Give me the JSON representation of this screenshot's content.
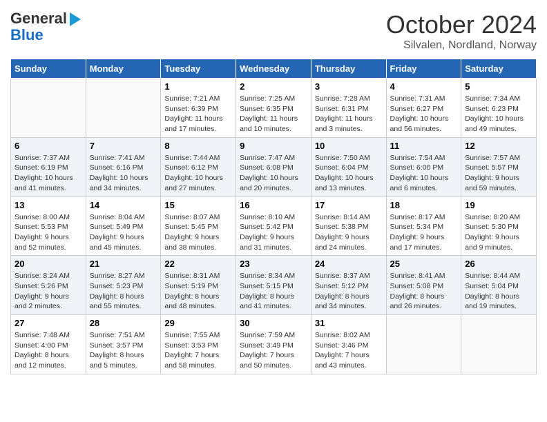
{
  "header": {
    "logo_line1": "General",
    "logo_line2": "Blue",
    "month": "October 2024",
    "location": "Silvalen, Nordland, Norway"
  },
  "weekdays": [
    "Sunday",
    "Monday",
    "Tuesday",
    "Wednesday",
    "Thursday",
    "Friday",
    "Saturday"
  ],
  "weeks": [
    [
      {
        "day": "",
        "info": ""
      },
      {
        "day": "",
        "info": ""
      },
      {
        "day": "1",
        "info": "Sunrise: 7:21 AM\nSunset: 6:39 PM\nDaylight: 11 hours and 17 minutes."
      },
      {
        "day": "2",
        "info": "Sunrise: 7:25 AM\nSunset: 6:35 PM\nDaylight: 11 hours and 10 minutes."
      },
      {
        "day": "3",
        "info": "Sunrise: 7:28 AM\nSunset: 6:31 PM\nDaylight: 11 hours and 3 minutes."
      },
      {
        "day": "4",
        "info": "Sunrise: 7:31 AM\nSunset: 6:27 PM\nDaylight: 10 hours and 56 minutes."
      },
      {
        "day": "5",
        "info": "Sunrise: 7:34 AM\nSunset: 6:23 PM\nDaylight: 10 hours and 49 minutes."
      }
    ],
    [
      {
        "day": "6",
        "info": "Sunrise: 7:37 AM\nSunset: 6:19 PM\nDaylight: 10 hours and 41 minutes."
      },
      {
        "day": "7",
        "info": "Sunrise: 7:41 AM\nSunset: 6:16 PM\nDaylight: 10 hours and 34 minutes."
      },
      {
        "day": "8",
        "info": "Sunrise: 7:44 AM\nSunset: 6:12 PM\nDaylight: 10 hours and 27 minutes."
      },
      {
        "day": "9",
        "info": "Sunrise: 7:47 AM\nSunset: 6:08 PM\nDaylight: 10 hours and 20 minutes."
      },
      {
        "day": "10",
        "info": "Sunrise: 7:50 AM\nSunset: 6:04 PM\nDaylight: 10 hours and 13 minutes."
      },
      {
        "day": "11",
        "info": "Sunrise: 7:54 AM\nSunset: 6:00 PM\nDaylight: 10 hours and 6 minutes."
      },
      {
        "day": "12",
        "info": "Sunrise: 7:57 AM\nSunset: 5:57 PM\nDaylight: 9 hours and 59 minutes."
      }
    ],
    [
      {
        "day": "13",
        "info": "Sunrise: 8:00 AM\nSunset: 5:53 PM\nDaylight: 9 hours and 52 minutes."
      },
      {
        "day": "14",
        "info": "Sunrise: 8:04 AM\nSunset: 5:49 PM\nDaylight: 9 hours and 45 minutes."
      },
      {
        "day": "15",
        "info": "Sunrise: 8:07 AM\nSunset: 5:45 PM\nDaylight: 9 hours and 38 minutes."
      },
      {
        "day": "16",
        "info": "Sunrise: 8:10 AM\nSunset: 5:42 PM\nDaylight: 9 hours and 31 minutes."
      },
      {
        "day": "17",
        "info": "Sunrise: 8:14 AM\nSunset: 5:38 PM\nDaylight: 9 hours and 24 minutes."
      },
      {
        "day": "18",
        "info": "Sunrise: 8:17 AM\nSunset: 5:34 PM\nDaylight: 9 hours and 17 minutes."
      },
      {
        "day": "19",
        "info": "Sunrise: 8:20 AM\nSunset: 5:30 PM\nDaylight: 9 hours and 9 minutes."
      }
    ],
    [
      {
        "day": "20",
        "info": "Sunrise: 8:24 AM\nSunset: 5:26 PM\nDaylight: 9 hours and 2 minutes."
      },
      {
        "day": "21",
        "info": "Sunrise: 8:27 AM\nSunset: 5:23 PM\nDaylight: 8 hours and 55 minutes."
      },
      {
        "day": "22",
        "info": "Sunrise: 8:31 AM\nSunset: 5:19 PM\nDaylight: 8 hours and 48 minutes."
      },
      {
        "day": "23",
        "info": "Sunrise: 8:34 AM\nSunset: 5:15 PM\nDaylight: 8 hours and 41 minutes."
      },
      {
        "day": "24",
        "info": "Sunrise: 8:37 AM\nSunset: 5:12 PM\nDaylight: 8 hours and 34 minutes."
      },
      {
        "day": "25",
        "info": "Sunrise: 8:41 AM\nSunset: 5:08 PM\nDaylight: 8 hours and 26 minutes."
      },
      {
        "day": "26",
        "info": "Sunrise: 8:44 AM\nSunset: 5:04 PM\nDaylight: 8 hours and 19 minutes."
      }
    ],
    [
      {
        "day": "27",
        "info": "Sunrise: 7:48 AM\nSunset: 4:00 PM\nDaylight: 8 hours and 12 minutes."
      },
      {
        "day": "28",
        "info": "Sunrise: 7:51 AM\nSunset: 3:57 PM\nDaylight: 8 hours and 5 minutes."
      },
      {
        "day": "29",
        "info": "Sunrise: 7:55 AM\nSunset: 3:53 PM\nDaylight: 7 hours and 58 minutes."
      },
      {
        "day": "30",
        "info": "Sunrise: 7:59 AM\nSunset: 3:49 PM\nDaylight: 7 hours and 50 minutes."
      },
      {
        "day": "31",
        "info": "Sunrise: 8:02 AM\nSunset: 3:46 PM\nDaylight: 7 hours and 43 minutes."
      },
      {
        "day": "",
        "info": ""
      },
      {
        "day": "",
        "info": ""
      }
    ]
  ]
}
